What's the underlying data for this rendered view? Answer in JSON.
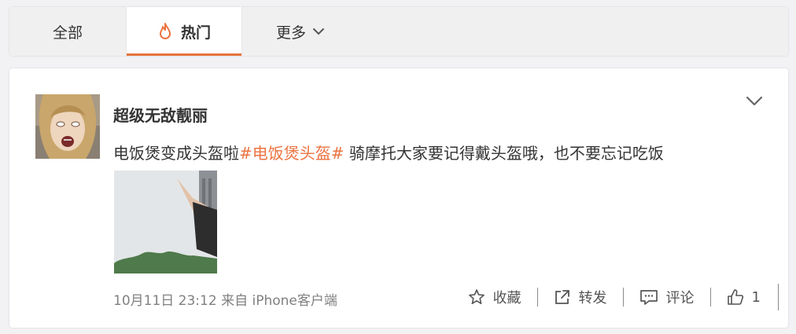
{
  "tabs": {
    "all_label": "全部",
    "hot_label": "热门",
    "more_label": "更多"
  },
  "post": {
    "username": "超级无敌靓丽",
    "text_before": "电饭煲变成头盔啦",
    "hashtag": "#电饭煲头盔#",
    "text_after": " 骑摩托大家要记得戴头盔哦，也不要忘记吃饭",
    "timestamp": "10月11日 23:12",
    "source": "来自 iPhone客户端"
  },
  "actions": {
    "favorite_label": "收藏",
    "repost_label": "转发",
    "comment_label": "评论",
    "like_count": "1"
  },
  "colors": {
    "accent": "#eb7340",
    "tab_underline": "#e8743b"
  },
  "icons": {
    "hot": "flame-icon",
    "more": "chevron-down-icon",
    "menu": "chevron-down-icon",
    "favorite": "star-icon",
    "repost": "share-icon",
    "comment": "comment-icon",
    "like": "thumbs-up-icon"
  }
}
